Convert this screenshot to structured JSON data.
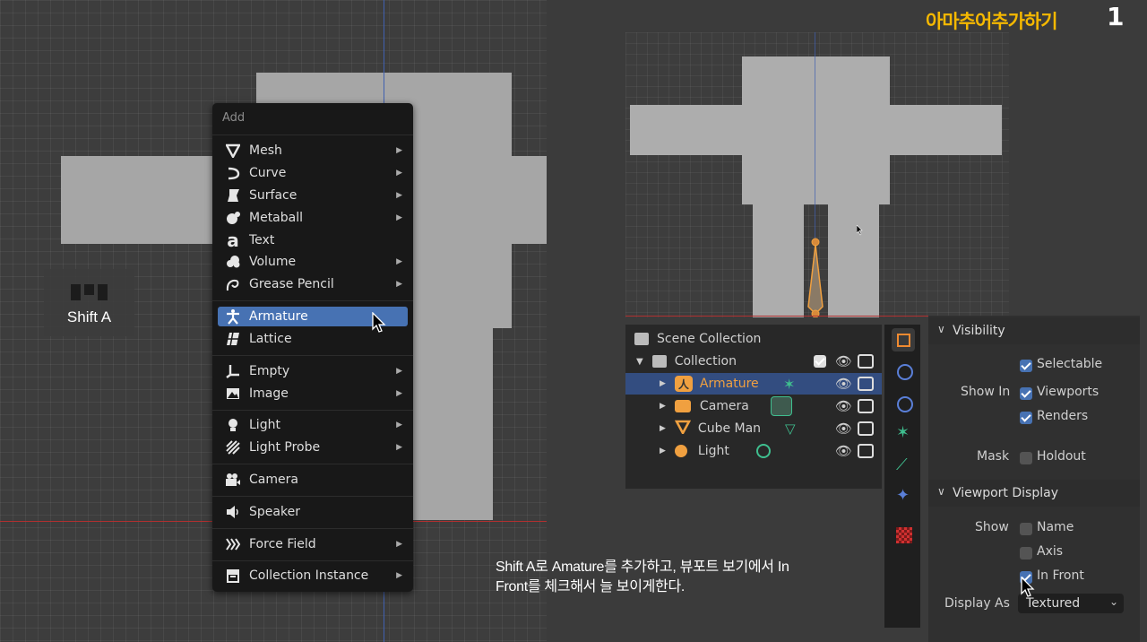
{
  "overlay": {
    "title": "아마추어추가하기",
    "step": "1",
    "caption_line1": "Shift A로 Amature를 추가하고, 뷰포트 보기에서 In",
    "caption_line2": "Front를 체크해서 늘 보이게한다."
  },
  "key_hint": {
    "label": "Shift A"
  },
  "add_menu": {
    "title": "Add",
    "items": [
      {
        "label": "Mesh",
        "icon": "mesh-icon",
        "submenu": true
      },
      {
        "label": "Curve",
        "icon": "curve-icon",
        "submenu": true
      },
      {
        "label": "Surface",
        "icon": "surface-icon",
        "submenu": true
      },
      {
        "label": "Metaball",
        "icon": "metaball-icon",
        "submenu": true
      },
      {
        "label": "Text",
        "icon": "text-icon",
        "submenu": false
      },
      {
        "label": "Volume",
        "icon": "volume-icon",
        "submenu": true
      },
      {
        "label": "Grease Pencil",
        "icon": "grease-pencil-icon",
        "submenu": true
      },
      {
        "label": "Armature",
        "icon": "armature-icon",
        "submenu": false,
        "selected": true
      },
      {
        "label": "Lattice",
        "icon": "lattice-icon",
        "submenu": false
      },
      {
        "label": "Empty",
        "icon": "empty-icon",
        "submenu": true
      },
      {
        "label": "Image",
        "icon": "image-icon",
        "submenu": true
      },
      {
        "label": "Light",
        "icon": "light-icon",
        "submenu": true
      },
      {
        "label": "Light Probe",
        "icon": "light-probe-icon",
        "submenu": true
      },
      {
        "label": "Camera",
        "icon": "camera-icon",
        "submenu": false
      },
      {
        "label": "Speaker",
        "icon": "speaker-icon",
        "submenu": false
      },
      {
        "label": "Force Field",
        "icon": "force-field-icon",
        "submenu": true
      },
      {
        "label": "Collection Instance",
        "icon": "collection-instance-icon",
        "submenu": true
      }
    ]
  },
  "outliner": {
    "scene_collection": "Scene Collection",
    "collection": "Collection",
    "objects": [
      {
        "label": "Armature",
        "color": "#f0a040",
        "selected": true
      },
      {
        "label": "Camera",
        "color": "#d0d0d0"
      },
      {
        "label": "Cube Man",
        "color": "#d0d0d0"
      },
      {
        "label": "Light",
        "color": "#d0d0d0"
      }
    ]
  },
  "properties": {
    "visibility_header": "Visibility",
    "selectable": "Selectable",
    "show_in": "Show In",
    "viewports": "Viewports",
    "renders": "Renders",
    "mask": "Mask",
    "holdout": "Holdout",
    "viewport_display_header": "Viewport Display",
    "show": "Show",
    "name": "Name",
    "axis": "Axis",
    "in_front": "In Front",
    "display_as": "Display As",
    "display_as_value": "Textured"
  },
  "colors": {
    "accent": "#4772b3",
    "title_yellow": "#f5b800",
    "armature_orange": "#f0a040",
    "data_green": "#3fbf8f"
  }
}
